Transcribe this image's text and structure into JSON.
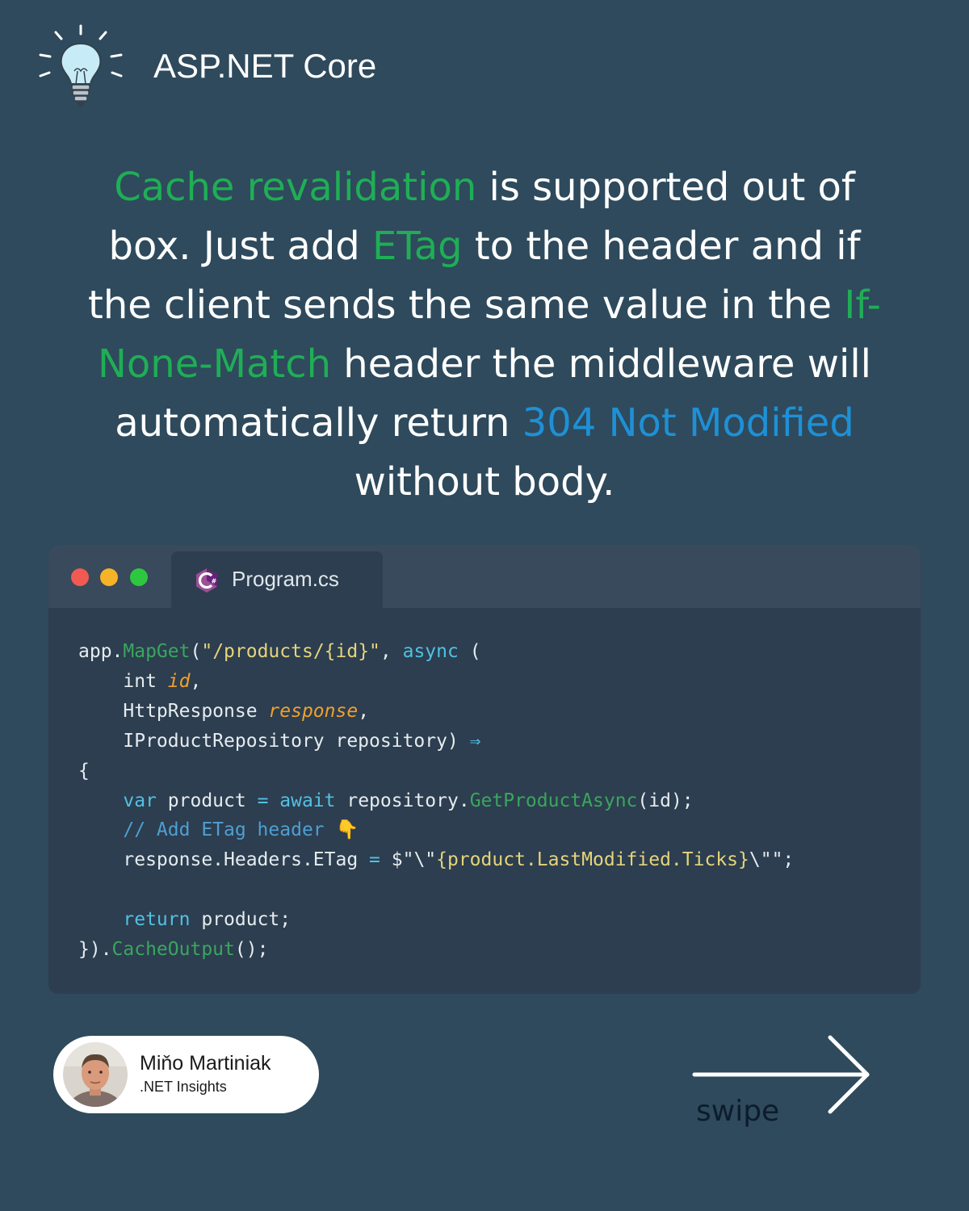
{
  "header": {
    "icon": "lightbulb-icon",
    "title": "ASP.NET Core"
  },
  "headline": {
    "p1": "Cache revalidation",
    "p2": " is supported out of box. Just add ",
    "p3": "ETag",
    "p4": " to the header and if the client sends the same value in the ",
    "p5": "If-None-Match",
    "p6": " header the middleware will automatically return ",
    "p7": "304 Not Modified",
    "p8": " without body."
  },
  "colors": {
    "background": "#2e4a5c",
    "highlight_green": "#1fae55",
    "highlight_blue": "#1e90d6",
    "code_bg": "#2c3e4f"
  },
  "editor": {
    "tab_icon": "csharp-icon",
    "tab_label": "Program.cs",
    "code": {
      "l1_a": "app.",
      "l1_fn": "MapGet",
      "l1_b": "(",
      "l1_str": "\"/products/{id}\"",
      "l1_c": ", ",
      "l1_kw": "async",
      "l1_d": " (",
      "l2_a": "    int ",
      "l2_p": "id",
      "l2_b": ",",
      "l3_a": "    HttpResponse ",
      "l3_p": "response",
      "l3_b": ",",
      "l4_a": "    IProductRepository repository) ",
      "l4_arrow": "⇒",
      "l5": "{",
      "l6_kw1": "    var",
      "l6_a": " product ",
      "l6_op": "=",
      "l6_kw2": " await",
      "l6_b": " repository.",
      "l6_fn": "GetProductAsync",
      "l6_c": "(id);",
      "l7_cmt": "    // Add ETag header ",
      "l7_emoji": "👇",
      "l8_a": "    response.Headers.ETag ",
      "l8_op": "=",
      "l8_b": " $",
      "l8_s1": "\"\\\"",
      "l8_s2": "{product.LastModified.Ticks}",
      "l8_s3": "\\\"\"",
      "l8_c": ";",
      "l9_kw": "    return",
      "l9_a": " product;",
      "l10_a": "}).",
      "l10_fn": "CacheOutput",
      "l10_b": "();"
    }
  },
  "author": {
    "avatar": "author-avatar",
    "name": "Miňo Martiniak",
    "subtitle": ".NET Insights"
  },
  "swipe": {
    "icon": "arrow-right-icon",
    "label": "swipe"
  }
}
